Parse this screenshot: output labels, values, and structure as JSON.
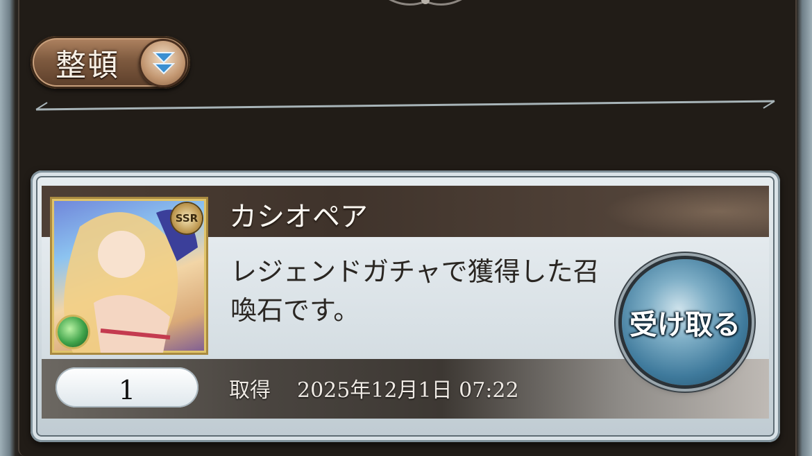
{
  "toolbar": {
    "sort_label": "整頓"
  },
  "item": {
    "name": "カシオペア",
    "description": "レジェンドガチャで獲得した召喚石です。",
    "rarity": "SSR",
    "quantity": "1",
    "acquired_label": "取得",
    "acquired_date": "2025年12月1日 07:22",
    "receive_label": "受け取る"
  },
  "colors": {
    "panel_bg": "#211c17",
    "title_band": "#4e3f35",
    "button_blue": "#3f7a9c"
  }
}
